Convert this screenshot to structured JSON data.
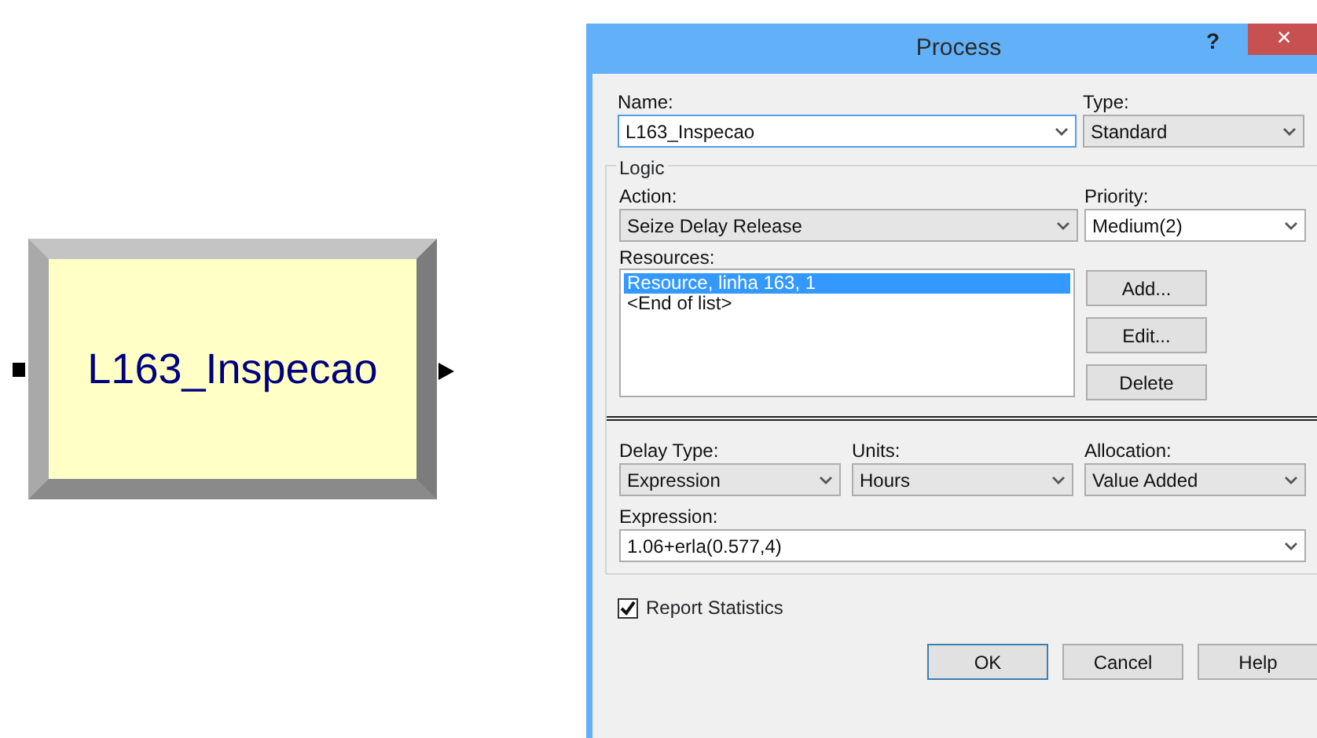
{
  "module": {
    "label": "L163_Inspecao"
  },
  "dialog": {
    "title": "Process",
    "help_button": "?",
    "close_button": "×",
    "name": {
      "label": "Name:",
      "value": "L163_Inspecao",
      "kind": "combo",
      "focused": true
    },
    "type": {
      "label": "Type:",
      "value": "Standard",
      "kind": "dropdown",
      "focused": false
    },
    "logic": {
      "label": "Logic",
      "action": {
        "label": "Action:",
        "value": "Seize Delay Release",
        "kind": "dropdown",
        "focused": false
      },
      "priority": {
        "label": "Priority:",
        "value": "Medium(2)",
        "kind": "combo",
        "focused": false
      },
      "resources_label": "Resources:",
      "resources": [
        {
          "text": "Resource, linha 163, 1",
          "selected": true
        },
        {
          "text": "<End of list>",
          "selected": false
        }
      ],
      "resource_buttons": [
        "Add...",
        "Edit...",
        "Delete"
      ],
      "delay_type": {
        "label": "Delay Type:",
        "value": "Expression",
        "kind": "dropdown",
        "focused": false
      },
      "units": {
        "label": "Units:",
        "value": "Hours",
        "kind": "dropdown",
        "focused": false
      },
      "allocation": {
        "label": "Allocation:",
        "value": "Value Added",
        "kind": "dropdown",
        "focused": false
      },
      "expression": {
        "label": "Expression:",
        "value": "1.06+erla(0.577,4)",
        "kind": "combo",
        "focused": false
      }
    },
    "report_statistics": {
      "label": "Report Statistics",
      "checked": true
    },
    "buttons": [
      {
        "label": "OK",
        "default": true
      },
      {
        "label": "Cancel",
        "default": false
      },
      {
        "label": "Help",
        "default": false
      }
    ]
  }
}
